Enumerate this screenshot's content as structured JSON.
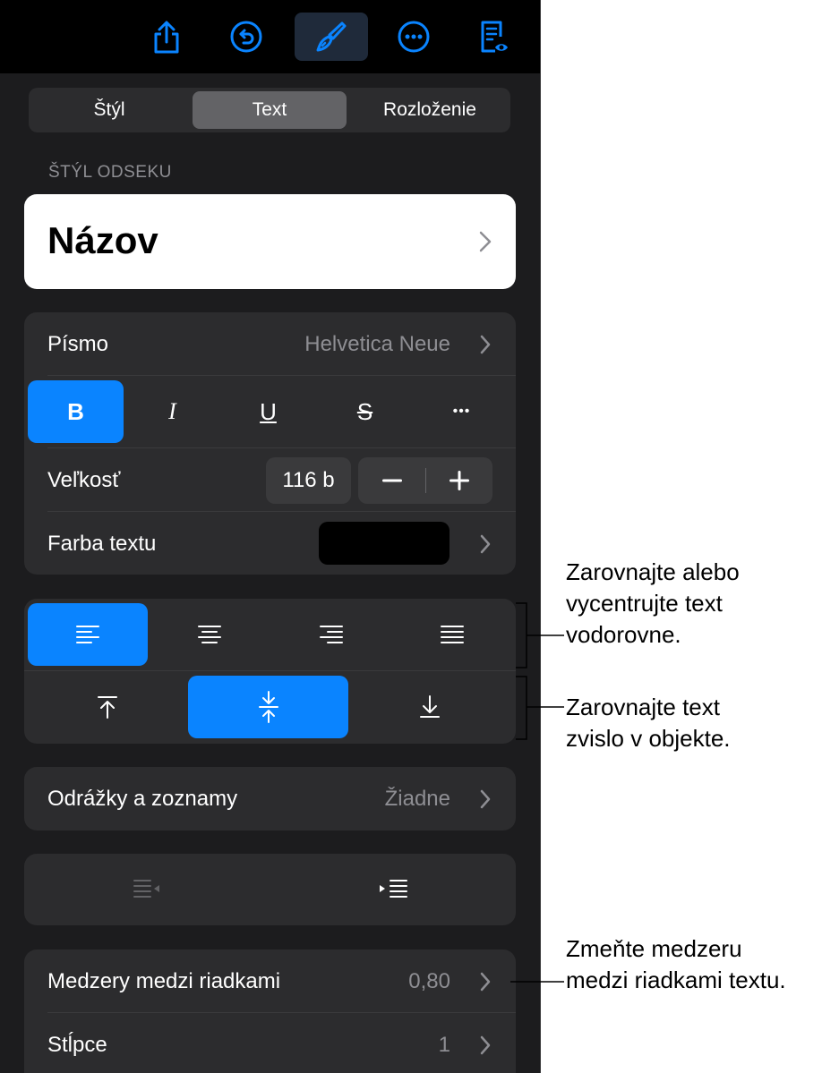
{
  "toolbar": {
    "icons": [
      "share-icon",
      "undo-icon",
      "paintbrush-icon",
      "more-icon",
      "reading-view-icon"
    ]
  },
  "tabs": [
    {
      "label": "Štýl"
    },
    {
      "label": "Text"
    },
    {
      "label": "Rozloženie"
    }
  ],
  "paragraph_style": {
    "section_label": "ŠTÝL ODSEKU",
    "value": "Názov"
  },
  "font": {
    "label": "Písmo",
    "value": "Helvetica Neue",
    "styles": {
      "bold": "B",
      "italic": "I",
      "underline": "U",
      "strikethrough": "S",
      "more": "•••"
    },
    "size_label": "Veľkosť",
    "size_value": "116 b",
    "color_label": "Farba textu",
    "color_value": "#000000"
  },
  "bullets": {
    "label": "Odrážky a zoznamy",
    "value": "Žiadne"
  },
  "line_spacing": {
    "label": "Medzery medzi riadkami",
    "value": "0,80"
  },
  "columns": {
    "label": "Stĺpce",
    "value": "1"
  },
  "callouts": {
    "horizontal": [
      "Zarovnajte alebo",
      "vycentrujte text",
      "vodorovne."
    ],
    "vertical": [
      "Zarovnajte text",
      "zvislo v objekte."
    ],
    "spacing": [
      "Zmeňte medzeru",
      "medzi riadkami textu."
    ]
  },
  "colors": {
    "accent": "#0a84ff",
    "panel": "#1c1c1e",
    "group": "#2c2c2e"
  }
}
